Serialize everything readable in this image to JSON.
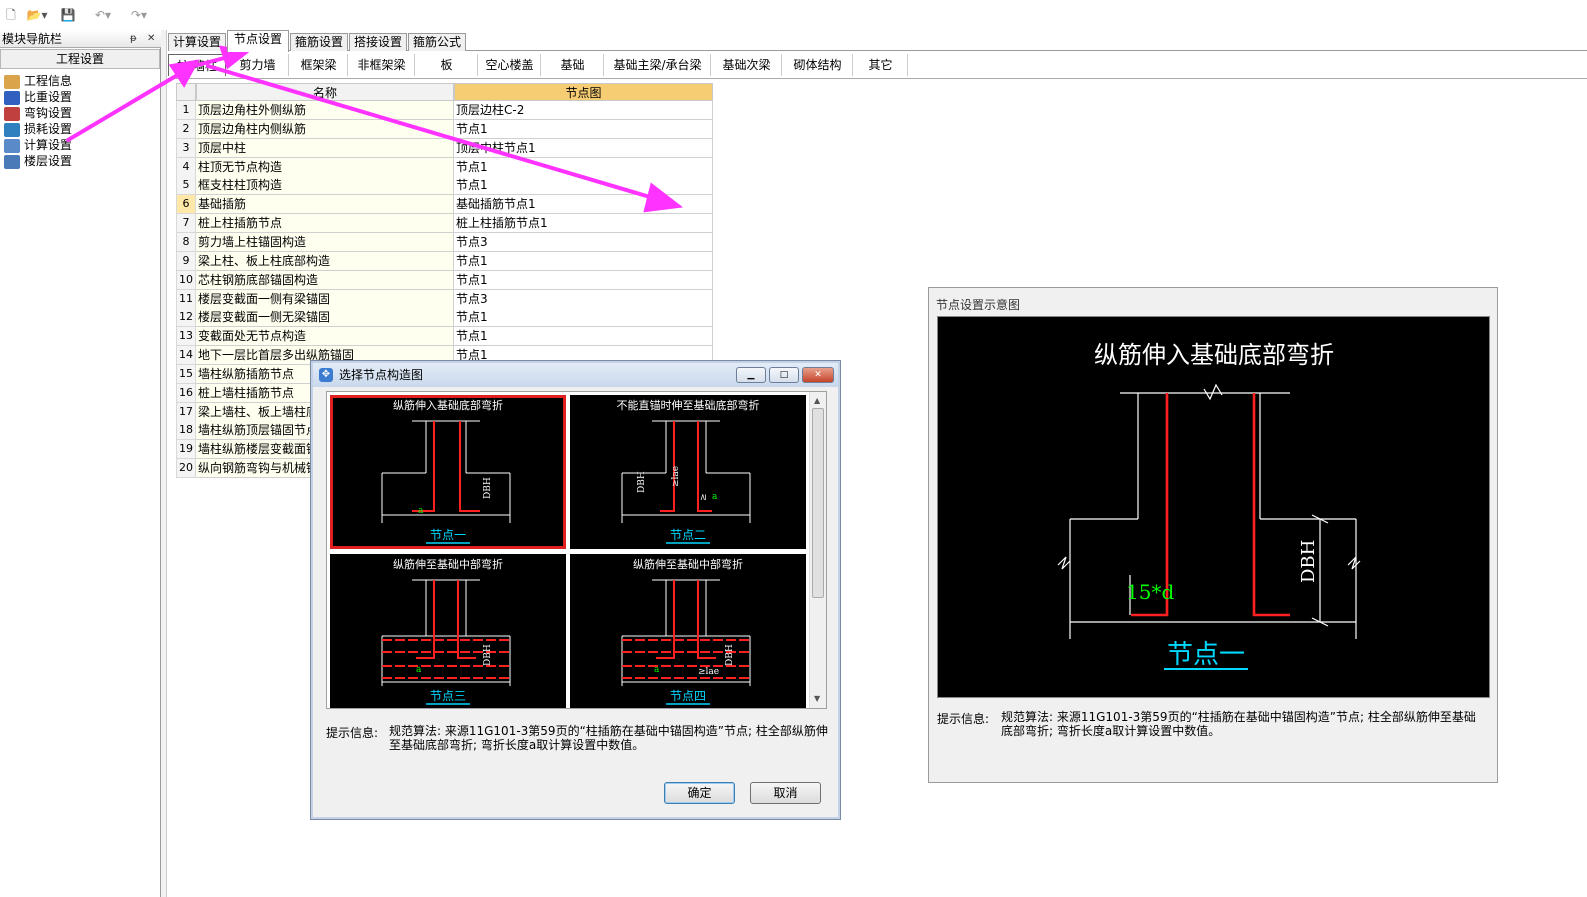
{
  "navigator": {
    "title": "模块导航栏",
    "pin": "ᵽ",
    "close": "✕",
    "header_tab": "工程设置",
    "items": [
      {
        "label": "工程信息",
        "icon": "folder-info-icon"
      },
      {
        "label": "比重设置",
        "icon": "weight-icon"
      },
      {
        "label": "弯钩设置",
        "icon": "hook-icon"
      },
      {
        "label": "损耗设置",
        "icon": "loss-icon"
      },
      {
        "label": "计算设置",
        "icon": "calc-icon"
      },
      {
        "label": "楼层设置",
        "icon": "floor-icon"
      }
    ]
  },
  "tabs": [
    "计算设置",
    "节点设置",
    "箍筋设置",
    "搭接设置",
    "箍筋公式"
  ],
  "active_tab": 1,
  "subtabs": [
    "柱/墙柱",
    "剪力墙",
    "框架梁",
    "非框架梁",
    "板",
    "空心楼盖",
    "基础",
    "基础主梁/承台梁",
    "基础次梁",
    "砌体结构",
    "其它"
  ],
  "grid": {
    "headers": [
      "名称",
      "节点图"
    ],
    "rows": [
      {
        "n": "1",
        "name": "顶层边角柱外侧纵筋",
        "node": "顶层边柱C-2"
      },
      {
        "n": "2",
        "name": "顶层边角柱内侧纵筋",
        "node": "节点1"
      },
      {
        "n": "3",
        "name": "顶层中柱",
        "node": "顶层中柱节点1"
      },
      {
        "n": "4",
        "name": "柱顶无节点构造",
        "node": "节点1"
      },
      {
        "n": "5",
        "name": "框支柱柱顶构造",
        "node": "节点1"
      },
      {
        "n": "6",
        "name": "基础插筋",
        "node": "基础插筋节点1"
      },
      {
        "n": "7",
        "name": "桩上柱插筋节点",
        "node": "桩上柱插筋节点1"
      },
      {
        "n": "8",
        "name": "剪力墙上柱锚固构造",
        "node": "节点3"
      },
      {
        "n": "9",
        "name": "梁上柱、板上柱底部构造",
        "node": "节点1"
      },
      {
        "n": "10",
        "name": "芯柱钢筋底部锚固构造",
        "node": "节点1"
      },
      {
        "n": "11",
        "name": "楼层变截面一侧有梁锚固",
        "node": "节点3"
      },
      {
        "n": "12",
        "name": "楼层变截面一侧无梁锚固",
        "node": "节点1"
      },
      {
        "n": "13",
        "name": "变截面处无节点构造",
        "node": "节点1"
      },
      {
        "n": "14",
        "name": "地下一层比首层多出纵筋锚固",
        "node": "节点1"
      },
      {
        "n": "15",
        "name": "墙柱纵筋插筋节点",
        "node": ""
      },
      {
        "n": "16",
        "name": "桩上墙柱插筋节点",
        "node": ""
      },
      {
        "n": "17",
        "name": "梁上墙柱、板上墙柱底部构造",
        "node": ""
      },
      {
        "n": "18",
        "name": "墙柱纵筋顶层锚固节点",
        "node": ""
      },
      {
        "n": "19",
        "name": "墙柱纵筋楼层变截面锚固",
        "node": ""
      },
      {
        "n": "20",
        "name": "纵向钢筋弯钩与机械锚固",
        "node": ""
      }
    ],
    "selected_row": 6,
    "ellipsis": "···"
  },
  "dialog": {
    "title": "选择节点构造图",
    "buttons": {
      "min": "▁",
      "max": "□",
      "close": "✕"
    },
    "thumbs": [
      {
        "title": "纵筋伸入基础底部弯折",
        "caption": "节点一",
        "dims": [
          "a",
          "DBH"
        ]
      },
      {
        "title": "不能直锚时伸至基础底部弯折",
        "caption": "节点二",
        "dims": [
          "DBH",
          "≥lae",
          "a",
          "≥"
        ]
      },
      {
        "title": "纵筋伸至基础中部弯折",
        "caption": "节点三",
        "dims": [
          "a",
          "DBH"
        ]
      },
      {
        "title": "纵筋伸至基础中部弯折",
        "caption": "节点四",
        "dims": [
          "a",
          "≥lae",
          "DBH"
        ]
      }
    ],
    "hint_label": "提示信息:",
    "hint_text": "规范算法: 来源11G101-3第59页的“柱插筋在基础中锚固构造”节点; 柱全部纵筋伸至基础底部弯折; 弯折长度a取计算设置中数值。",
    "ok": "确定",
    "cancel": "取消"
  },
  "preview": {
    "title": "节点设置示意图",
    "heading": "纵筋伸入基础底部弯折",
    "dim_a": "15*d",
    "dim_h": "DBH",
    "caption": "节点一",
    "hint_label": "提示信息:",
    "hint_text": "规范算法: 来源11G101-3第59页的“柱插筋在基础中锚固构造”节点; 柱全部纵筋伸至基础底部弯折; 弯折长度a取计算设置中数值。"
  },
  "colors": {
    "rebar": "#ff2020",
    "caption": "#00d8ff",
    "dim": "#00ff00",
    "line": "#ffffff",
    "annotation": "#ff33ff"
  }
}
